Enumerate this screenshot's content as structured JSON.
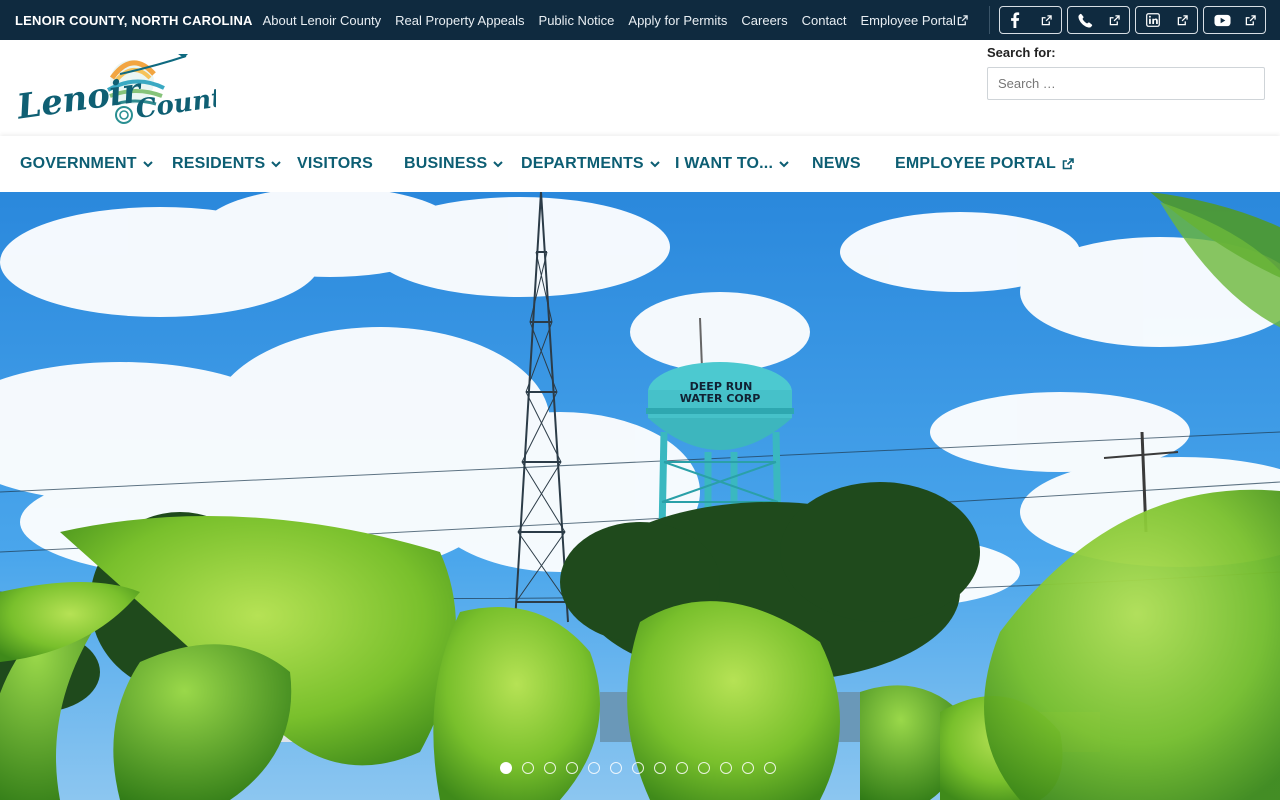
{
  "topbar": {
    "county_name": "LENOIR COUNTY, NORTH CAROLINA",
    "links": [
      {
        "label": "About Lenoir County"
      },
      {
        "label": "Real Property Appeals"
      },
      {
        "label": "Public Notice"
      },
      {
        "label": "Apply for Permits"
      },
      {
        "label": "Careers"
      },
      {
        "label": "Contact"
      },
      {
        "label": "Employee Portal",
        "external": true
      }
    ],
    "social": [
      {
        "icon": "facebook-icon"
      },
      {
        "icon": "phone-icon"
      },
      {
        "icon": "linkedin-icon"
      },
      {
        "icon": "youtube-icon"
      }
    ]
  },
  "header": {
    "logo_text_1": "Lenoir",
    "logo_text_2": "County",
    "search_label": "Search for:",
    "search_placeholder": "Search …"
  },
  "nav": {
    "items": [
      {
        "label": "GOVERNMENT",
        "dropdown": true
      },
      {
        "label": "RESIDENTS",
        "dropdown": true
      },
      {
        "label": "VISITORS",
        "dropdown": false
      },
      {
        "label": "BUSINESS",
        "dropdown": true
      },
      {
        "label": "DEPARTMENTS",
        "dropdown": true
      },
      {
        "label": "I WANT TO...",
        "dropdown": true
      },
      {
        "label": "NEWS",
        "dropdown": false
      },
      {
        "label": "EMPLOYEE PORTAL",
        "external": true
      }
    ]
  },
  "hero": {
    "tower_text_1": "DEEP RUN",
    "tower_text_2": "WATER CORP",
    "slide_count": 13,
    "active_slide": 1
  },
  "colors": {
    "topbar_bg": "#0f2a3f",
    "nav_text": "#0d5e73",
    "sky": "#2f8fe0"
  }
}
